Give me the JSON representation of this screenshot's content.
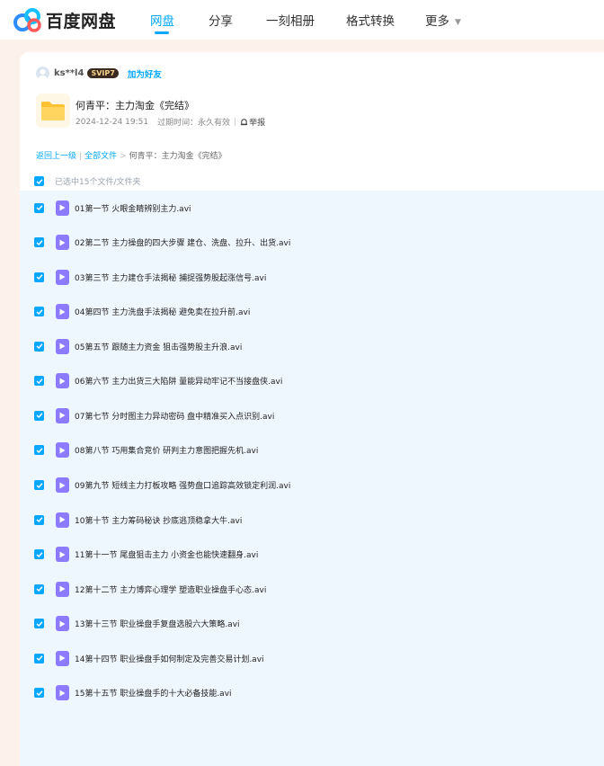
{
  "app": {
    "name": "百度网盘",
    "accent": "#06a7ff"
  },
  "nav": {
    "items": [
      {
        "label": "网盘",
        "active": true
      },
      {
        "label": "分享",
        "active": false
      },
      {
        "label": "一刻相册",
        "active": false
      },
      {
        "label": "格式转换",
        "active": false
      },
      {
        "label": "更多",
        "active": false
      }
    ]
  },
  "user": {
    "name": "ks**l4",
    "badge": "SVIP7",
    "add_friend": "加为好友"
  },
  "share": {
    "title": "何青平：主力淘金《完结》",
    "date": "2024-12-24 19:51",
    "expiry": "过期时间：永久有效",
    "report": "举报"
  },
  "breadcrumb": {
    "back": "返回上一级",
    "all": "全部文件",
    "current": "何青平：主力淘金《完结》"
  },
  "selection": {
    "info": "已选中15个文件/文件夹"
  },
  "files": [
    {
      "name": "01第一节 火眼金睛辨别主力.avi",
      "checked": true,
      "icon": "video-file-icon"
    },
    {
      "name": "02第二节 主力操盘的四大步骤 建仓、洗盘、拉升、出货.avi",
      "checked": true,
      "icon": "video-file-icon"
    },
    {
      "name": "03第三节 主力建仓手法揭秘 捕捉强势股起涨信号.avi",
      "checked": true,
      "icon": "video-file-icon"
    },
    {
      "name": "04第四节 主力洗盘手法揭秘 避免卖在拉升前.avi",
      "checked": true,
      "icon": "video-file-icon"
    },
    {
      "name": "05第五节 跟随主力资金 狙击强势股主升浪.avi",
      "checked": true,
      "icon": "video-file-icon"
    },
    {
      "name": "06第六节 主力出货三大陷阱 量能异动牢记不当接盘侠.avi",
      "checked": true,
      "icon": "video-file-icon"
    },
    {
      "name": "07第七节 分时图主力异动密码 盘中精准买入点识别.avi",
      "checked": true,
      "icon": "video-file-icon"
    },
    {
      "name": "08第八节 巧用集合竞价 研判主力意图把握先机.avi",
      "checked": true,
      "icon": "video-file-icon"
    },
    {
      "name": "09第九节 短线主力打板攻略 强势盘口追踪高效锁定利润.avi",
      "checked": true,
      "icon": "video-file-icon"
    },
    {
      "name": "10第十节 主力筹码秘诀 抄底逃顶稳拿大牛.avi",
      "checked": true,
      "icon": "video-file-icon"
    },
    {
      "name": "11第十一节 尾盘狙击主力 小资金也能快速翻身.avi",
      "checked": true,
      "icon": "video-file-icon"
    },
    {
      "name": "12第十二节 主力博弈心理学 塑造职业操盘手心态.avi",
      "checked": true,
      "icon": "video-file-icon"
    },
    {
      "name": "13第十三节 职业操盘手复盘选股六大策略.avi",
      "checked": true,
      "icon": "video-file-icon"
    },
    {
      "name": "14第十四节 职业操盘手如何制定及完善交易计划.avi",
      "checked": true,
      "icon": "video-file-icon"
    },
    {
      "name": "15第十五节 职业操盘手的十大必备技能.avi",
      "checked": true,
      "icon": "video-file-icon"
    }
  ]
}
